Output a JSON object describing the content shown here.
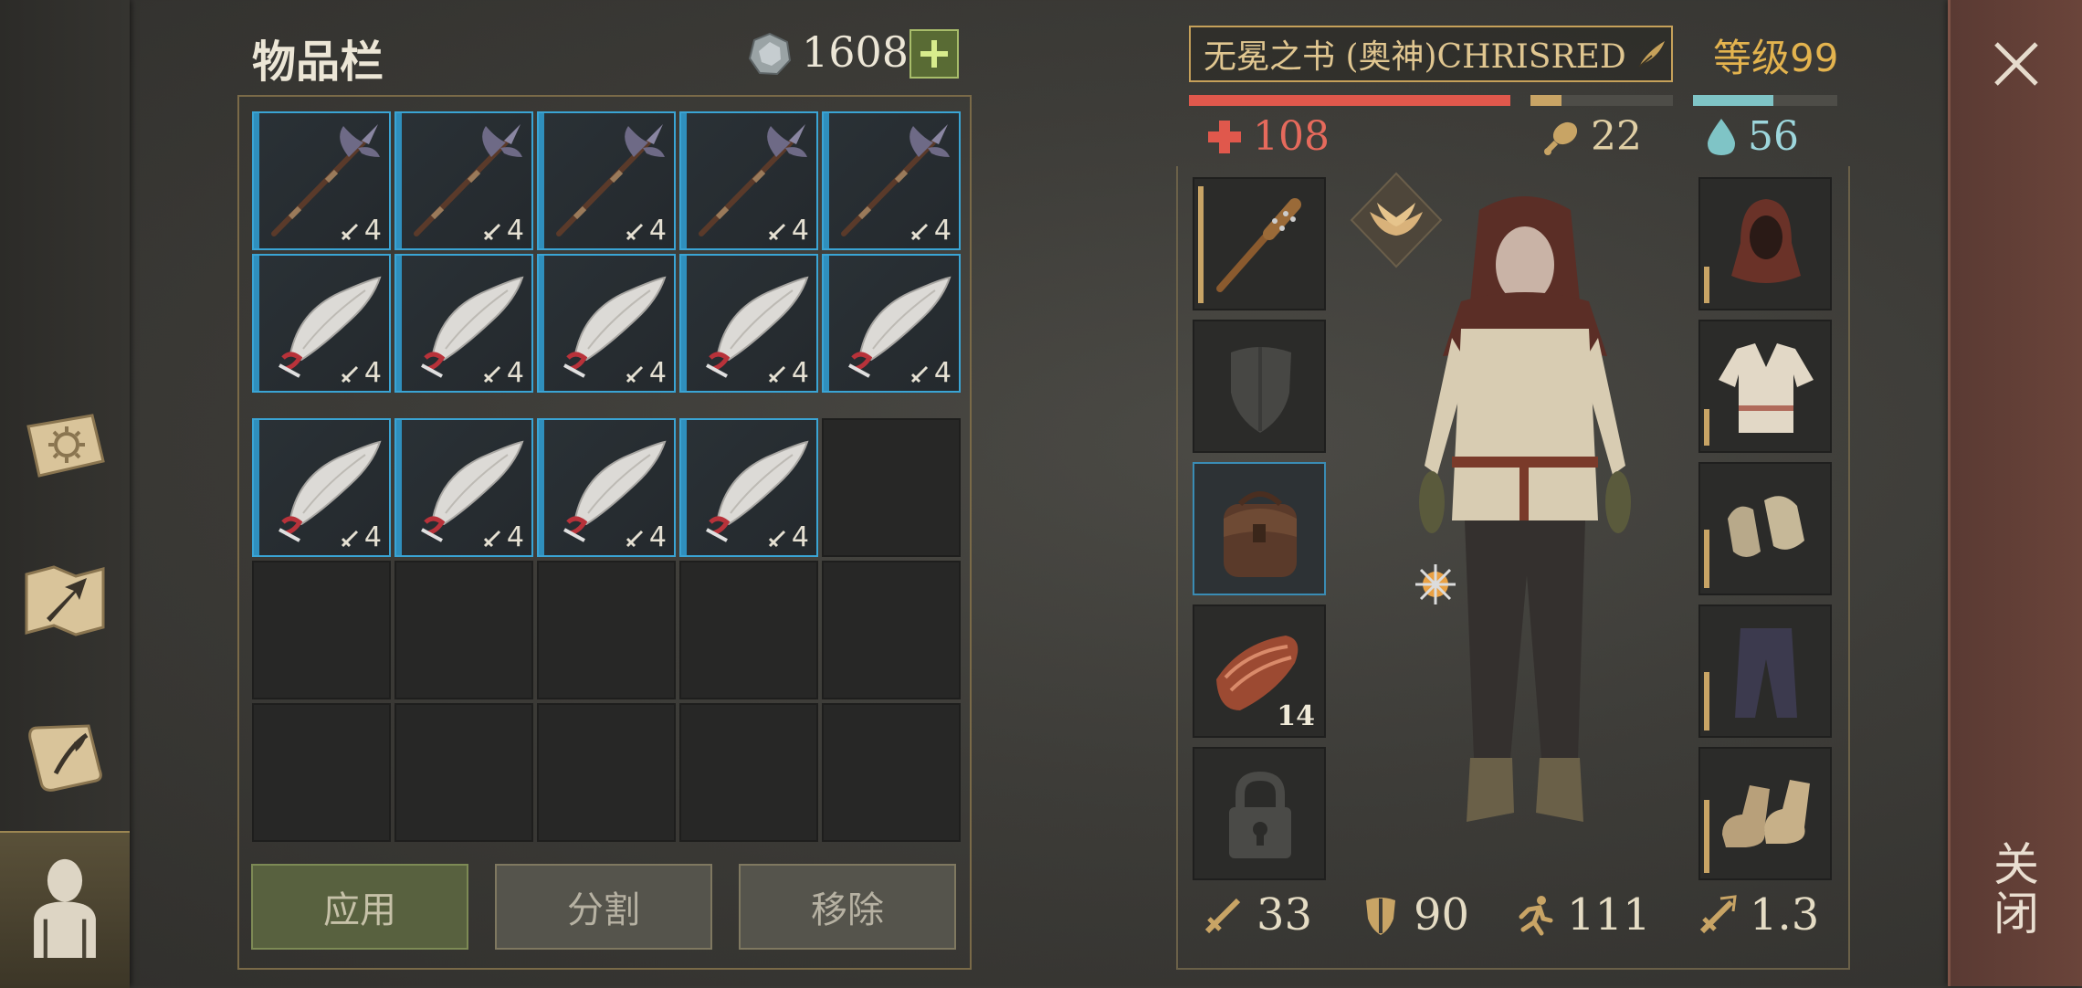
{
  "inventory": {
    "title": "物品栏",
    "currency": "1608",
    "add_label": "+",
    "item_level": "4",
    "slots": [
      "halberd",
      "halberd",
      "halberd",
      "halberd",
      "halberd",
      "scimitar",
      "scimitar",
      "scimitar",
      "scimitar",
      "scimitar",
      "scimitar",
      "scimitar",
      "scimitar",
      "scimitar",
      "empty",
      "empty",
      "empty",
      "empty",
      "empty",
      "empty",
      "empty",
      "empty",
      "empty",
      "empty",
      "empty"
    ],
    "buttons": {
      "apply": "应用",
      "split": "分割",
      "remove": "移除"
    }
  },
  "character": {
    "name": "无冕之书 (奥神)CHRISRED",
    "level": "等级99",
    "health": "108",
    "food": "22",
    "water": "56",
    "bars": {
      "health": 1.0,
      "food": 0.22,
      "water": 0.56
    },
    "left_equipment": [
      "spiked-club",
      "shield-placeholder",
      "backpack",
      "meat",
      "locked-slot"
    ],
    "right_equipment": [
      "hood",
      "tunic",
      "gloves",
      "pants",
      "boots"
    ],
    "meat_count": "14",
    "stats": {
      "attack": "33",
      "defense": "90",
      "speed": "111",
      "attack_speed": "1.3"
    }
  },
  "close_label": "关闭",
  "colors": {
    "rarity_blue": "#3aa4d4",
    "health": "#e0584c",
    "food": "#c8a465",
    "water": "#7fc4c6",
    "accent_gold": "#e3b34e"
  }
}
